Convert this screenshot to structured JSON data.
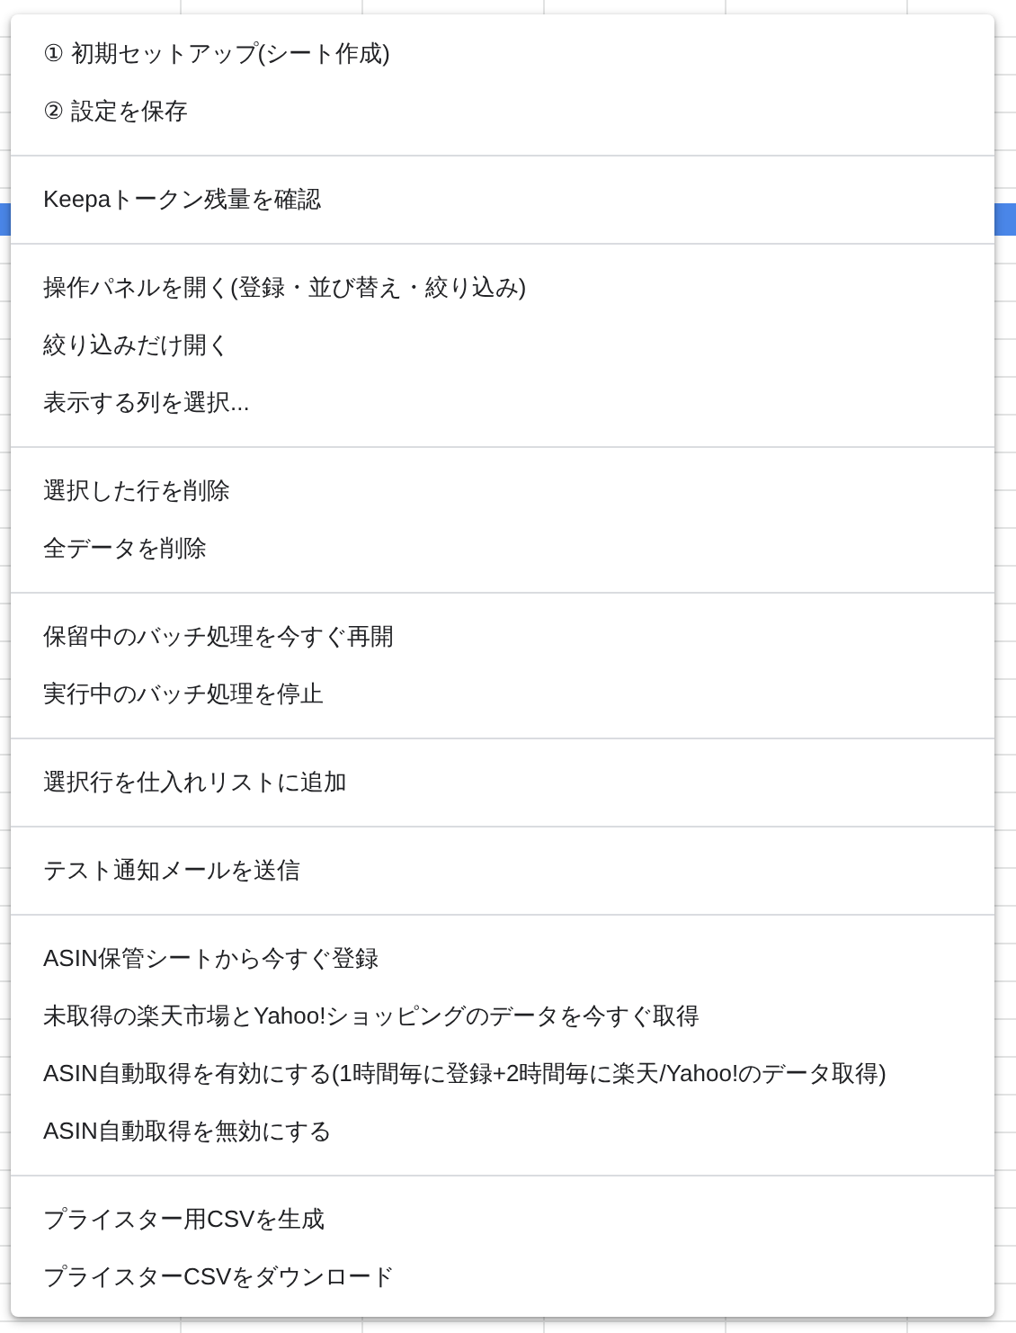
{
  "menu": {
    "groups": [
      {
        "items": [
          "① 初期セットアップ(シート作成)",
          "② 設定を保存"
        ]
      },
      {
        "items": [
          "Keepaトークン残量を確認"
        ]
      },
      {
        "items": [
          "操作パネルを開く(登録・並び替え・絞り込み)",
          "絞り込みだけ開く",
          "表示する列を選択..."
        ]
      },
      {
        "items": [
          "選択した行を削除",
          "全データを削除"
        ]
      },
      {
        "items": [
          "保留中のバッチ処理を今すぐ再開",
          "実行中のバッチ処理を停止"
        ]
      },
      {
        "items": [
          "選択行を仕入れリストに追加"
        ]
      },
      {
        "items": [
          "テスト通知メールを送信"
        ]
      },
      {
        "items": [
          "ASIN保管シートから今すぐ登録",
          "未取得の楽天市場とYahoo!ショッピングのデータを今すぐ取得",
          "ASIN自動取得を有効にする(1時間毎に登録+2時間毎に楽天/Yahoo!のデータ取得)",
          "ASIN自動取得を無効にする"
        ]
      },
      {
        "items": [
          "プライスター用CSVを生成",
          "プライスターCSVをダウンロード"
        ]
      }
    ]
  }
}
